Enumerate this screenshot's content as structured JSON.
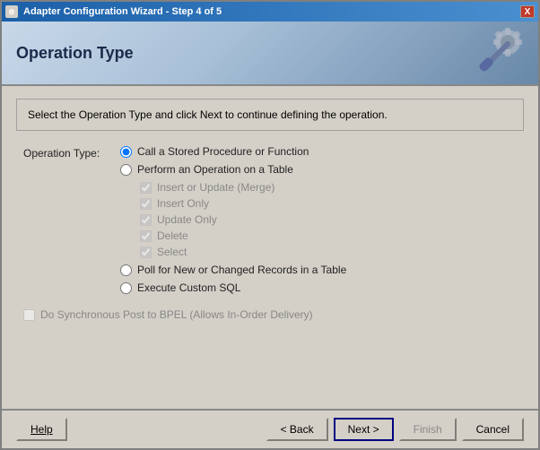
{
  "window": {
    "title": "Adapter Configuration Wizard - Step 4 of 5",
    "close_label": "X"
  },
  "header": {
    "title": "Operation Type"
  },
  "instruction": {
    "text": "Select the Operation Type and click Next to continue defining the operation."
  },
  "form": {
    "operation_type_label": "Operation Type:",
    "radio_options": [
      {
        "id": "radio-stored",
        "label": "Call a Stored Procedure or Function",
        "checked": true,
        "disabled": false
      },
      {
        "id": "radio-table",
        "label": "Perform an Operation on a Table",
        "checked": false,
        "disabled": false
      },
      {
        "id": "radio-poll",
        "label": "Poll for New or Changed Records in a Table",
        "checked": false,
        "disabled": false
      },
      {
        "id": "radio-sql",
        "label": "Execute Custom SQL",
        "checked": false,
        "disabled": false
      }
    ],
    "table_checkboxes": [
      {
        "id": "chk-insert-update",
        "label": "Insert or Update (Merge)",
        "checked": true
      },
      {
        "id": "chk-insert-only",
        "label": "Insert Only",
        "checked": true
      },
      {
        "id": "chk-update-only",
        "label": "Update Only",
        "checked": true
      },
      {
        "id": "chk-delete",
        "label": "Delete",
        "checked": true
      },
      {
        "id": "chk-select",
        "label": "Select",
        "checked": true
      }
    ],
    "sync_checkbox_label": "Do Synchronous Post to BPEL (Allows In-Order Delivery)"
  },
  "footer": {
    "help_label": "Help",
    "back_label": "< Back",
    "next_label": "Next >",
    "finish_label": "Finish",
    "cancel_label": "Cancel"
  }
}
